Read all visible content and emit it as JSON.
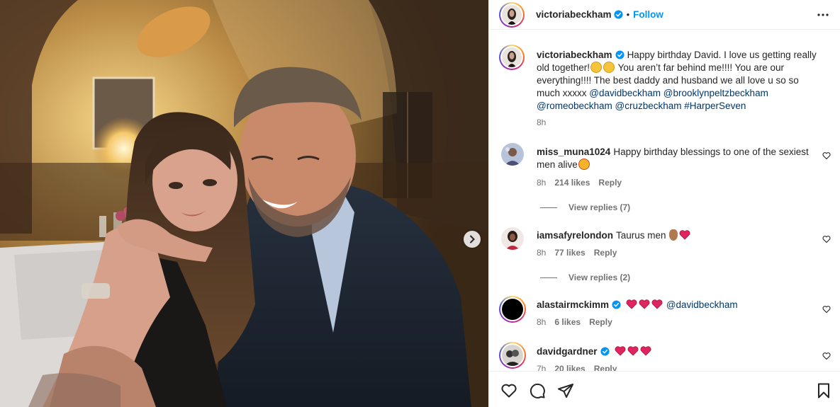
{
  "post": {
    "author": "victoriabeckham",
    "follow_label": "Follow",
    "separator": "•"
  },
  "caption": {
    "username": "victoriabeckham",
    "text_1": "Happy birthday David. I love us getting really old together!",
    "text_2": " You aren’t far behind me!!!! You are our everything!!!! The best daddy and husband we all love u so so much xxxxx ",
    "mentions": [
      "@davidbeckham",
      "@brooklynpeltzbeckham",
      "@romeobeckham",
      "@cruzbeckham",
      "#HarperSeven"
    ],
    "time": "8h"
  },
  "comments": [
    {
      "username": "miss_muna1024",
      "text": "Happy birthday blessings to one of the sexiest men alive",
      "time": "8h",
      "likes": "214 likes",
      "reply": "Reply",
      "view_replies": "View replies (7)"
    },
    {
      "username": "iamsafyrelondon",
      "text": "Taurus men ",
      "time": "8h",
      "likes": "77 likes",
      "reply": "Reply",
      "view_replies": "View replies (2)"
    },
    {
      "username": "alastairmckimm",
      "mention": "@davidbeckham",
      "time": "8h",
      "likes": "6 likes",
      "reply": "Reply"
    },
    {
      "username": "davidgardner",
      "time": "7h",
      "likes": "20 likes",
      "reply": "Reply"
    }
  ],
  "icons": {
    "more": "more-options-icon",
    "verified": "verified-badge-icon",
    "like": "heart-icon",
    "comment": "comment-icon",
    "share": "share-icon",
    "save": "bookmark-icon",
    "next": "chevron-right-icon"
  },
  "colors": {
    "accent": "#0095f6",
    "verified": "#0095f6",
    "heart_emoji": "#e0245e",
    "muted": "#737373"
  }
}
